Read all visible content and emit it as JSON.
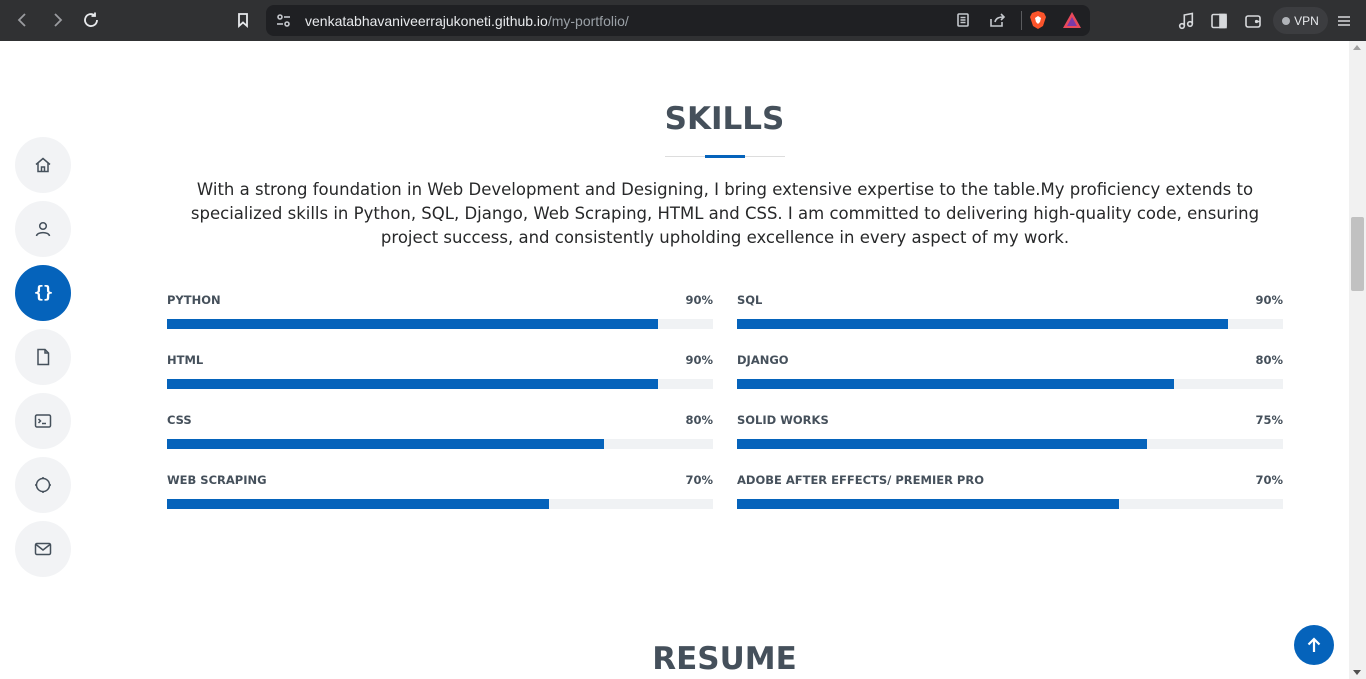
{
  "browser": {
    "url_host": "venkatabhavaniveerrajukoneti.github.io",
    "url_path": "/my-portfolio/",
    "vpn_label": "VPN"
  },
  "sidenav": {
    "items": [
      {
        "name": "home",
        "icon": "home-icon"
      },
      {
        "name": "about",
        "icon": "person-icon"
      },
      {
        "name": "skills",
        "icon": "braces-icon",
        "glyph": "{}"
      },
      {
        "name": "resume",
        "icon": "file-icon"
      },
      {
        "name": "portfolio",
        "icon": "terminal-icon"
      },
      {
        "name": "services",
        "icon": "circle-icon"
      },
      {
        "name": "contact",
        "icon": "envelope-icon"
      }
    ],
    "active": "skills"
  },
  "skills_section": {
    "title": "SKILLS",
    "intro": "With a strong foundation in Web Development and Designing, I bring extensive expertise to the table.My proficiency extends to specialized skills in Python, SQL, Django, Web Scraping, HTML and CSS. I am committed to delivering high-quality code, ensuring project success, and consistently upholding excellence in every aspect of my work.",
    "left": [
      {
        "name": "PYTHON",
        "value_label": "90%",
        "value": 90
      },
      {
        "name": "HTML",
        "value_label": "90%",
        "value": 90
      },
      {
        "name": "CSS",
        "value_label": "80%",
        "value": 80
      },
      {
        "name": "WEB SCRAPING",
        "value_label": "70%",
        "value": 70
      }
    ],
    "right": [
      {
        "name": "SQL",
        "value_label": "90%",
        "value": 90
      },
      {
        "name": "DJANGO",
        "value_label": "80%",
        "value": 80
      },
      {
        "name": "SOLID WORKS",
        "value_label": "75%",
        "value": 75
      },
      {
        "name": "ADOBE AFTER EFFECTS/ PREMIER PRO",
        "value_label": "70%",
        "value": 70
      }
    ]
  },
  "resume_section": {
    "title": "RESUME"
  },
  "colors": {
    "accent": "#0563bb",
    "text": "#45505b",
    "track": "#f0f2f4"
  }
}
